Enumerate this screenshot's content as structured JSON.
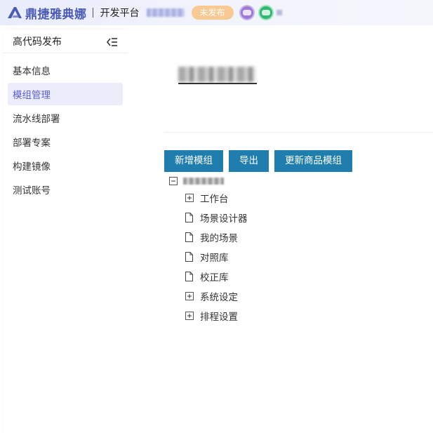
{
  "header": {
    "brand": "鼎捷雅典娜",
    "platform": "开发平台",
    "status_badge": "未发布",
    "brand_color": "#4a5bb5",
    "badge_color": "#f9c993"
  },
  "sidebar": {
    "title": "高代码发布",
    "collapse_icon": "menu-fold-icon",
    "items": [
      {
        "label": "基本信息",
        "active": false
      },
      {
        "label": "模组管理",
        "active": true
      },
      {
        "label": "流水线部署",
        "active": false
      },
      {
        "label": "部署专案",
        "active": false
      },
      {
        "label": "构建镜像",
        "active": false
      },
      {
        "label": "测试账号",
        "active": false
      }
    ],
    "active_color": "#5b5fd0"
  },
  "main": {
    "toolbar": {
      "add_module": "新增模组",
      "export": "导出",
      "update_product_module": "更新商品模组",
      "button_color": "#1f7eae"
    },
    "tree": {
      "root_expand_icon": "minus-square-icon",
      "nodes": [
        {
          "label": "工作台",
          "icon": "plus-square-icon"
        },
        {
          "label": "场景设计器",
          "icon": "file-icon"
        },
        {
          "label": "我的场景",
          "icon": "file-icon"
        },
        {
          "label": "对照库",
          "icon": "file-icon"
        },
        {
          "label": "校正库",
          "icon": "file-icon"
        },
        {
          "label": "系统设定",
          "icon": "plus-square-icon"
        },
        {
          "label": "排程设置",
          "icon": "plus-square-icon"
        }
      ]
    }
  }
}
